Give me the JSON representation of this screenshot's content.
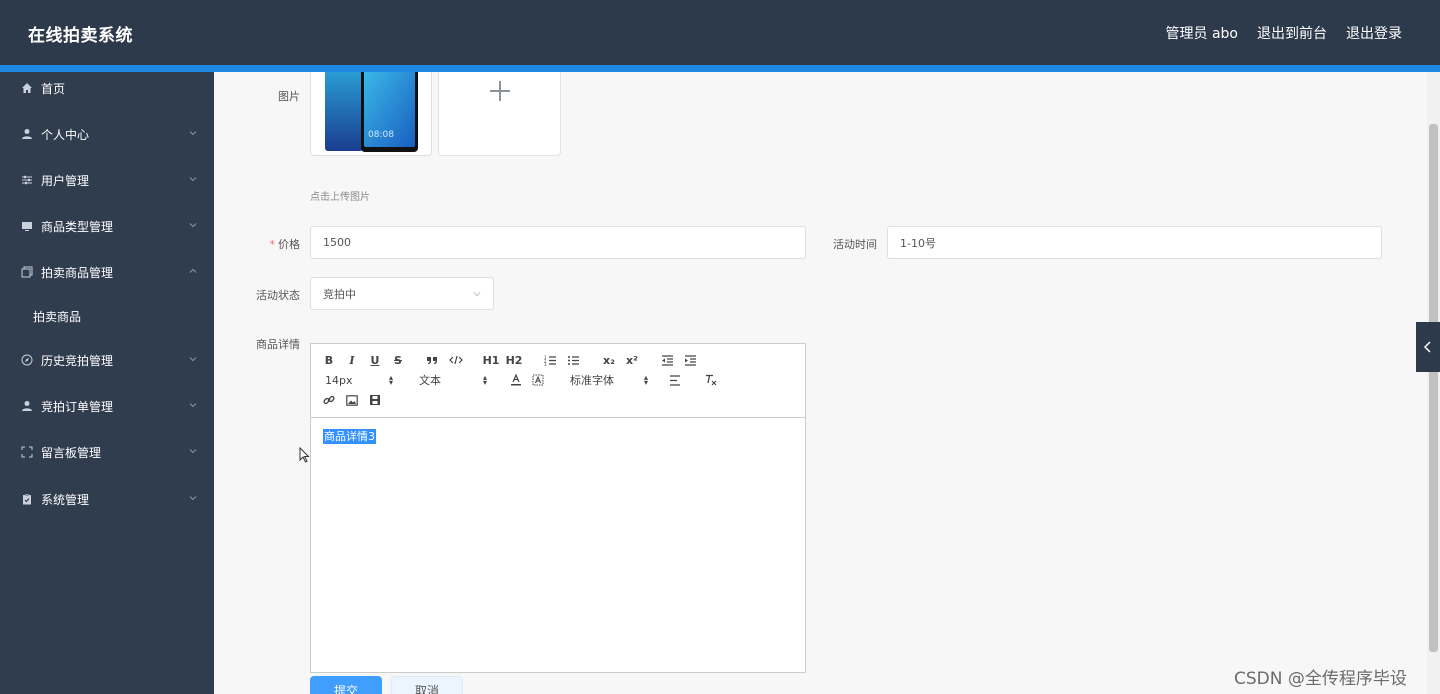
{
  "header": {
    "brand": "在线拍卖系统",
    "admin": "管理员 abo",
    "to_front": "退出到前台",
    "logout": "退出登录"
  },
  "sidebar": {
    "items": [
      {
        "label": "首页",
        "icon": "home-icon"
      },
      {
        "label": "个人中心",
        "icon": "user-icon"
      },
      {
        "label": "用户管理",
        "icon": "sliders-icon"
      },
      {
        "label": "商品类型管理",
        "icon": "monitor-icon"
      },
      {
        "label": "拍卖商品管理",
        "icon": "copy-icon"
      },
      {
        "label": "拍卖商品",
        "icon": ""
      },
      {
        "label": "历史竞拍管理",
        "icon": "compass-icon"
      },
      {
        "label": "竞拍订单管理",
        "icon": "user-icon"
      },
      {
        "label": "留言板管理",
        "icon": "expand-icon"
      },
      {
        "label": "系统管理",
        "icon": "clipboard-icon"
      }
    ]
  },
  "form": {
    "image_label": "图片",
    "upload_hint": "点击上传图片",
    "price_label": "价格",
    "price_value": "1500",
    "time_label": "活动时间",
    "time_value": "1-10号",
    "status_label": "活动状态",
    "status_value": "竞拍中",
    "detail_label": "商品详情",
    "detail_value": "商品详情3",
    "submit": "提交",
    "cancel": "取消"
  },
  "editor_toolbar": {
    "bold": "B",
    "italic": "I",
    "underline": "U",
    "strike": "S",
    "h1": "H1",
    "h2": "H2",
    "sub": "x₂",
    "sup": "x²",
    "size": "14px",
    "header": "文本",
    "font": "标准字体"
  },
  "thumb_screen_time": "08:08",
  "watermark": "CSDN @全传程序毕设",
  "colors": {
    "header_bg": "#2d3a4b",
    "accent": "#1e88e5",
    "sidebar_bg": "#2f3d4f",
    "primary": "#409eff"
  }
}
